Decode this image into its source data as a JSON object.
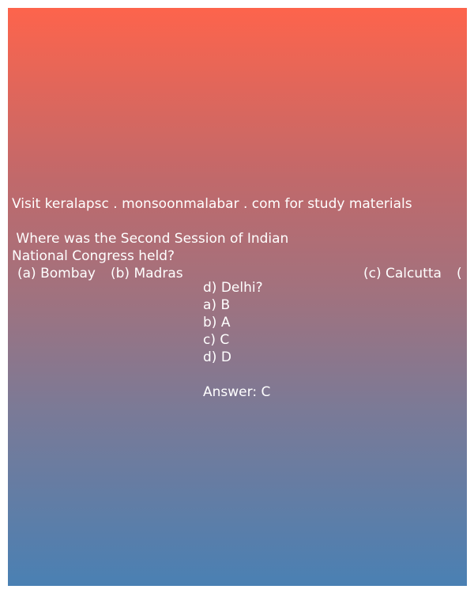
{
  "site_line": "Visit keralapsc . monsoonmalabar . com for study materials",
  "question": {
    "line1": " Where was the Second Session of Indian",
    "line2": "National Congress held?",
    "option_a": "(a) Bombay",
    "option_b": "(b) Madras",
    "option_c": "(c) Calcutta",
    "option_d_open": "(",
    "option_d": "d) Delhi?"
  },
  "choices": [
    "a) B",
    "b) A",
    "c) C",
    "d) D"
  ],
  "answer": "Answer: C",
  "colors": {
    "gradient_top": "#fd644c",
    "gradient_bottom": "#4a80b3",
    "text": "#ffffff"
  }
}
